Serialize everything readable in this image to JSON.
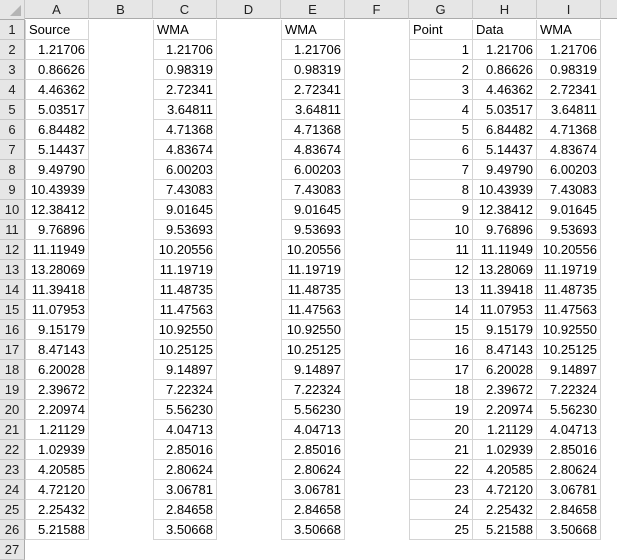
{
  "columns": [
    "A",
    "B",
    "C",
    "D",
    "E",
    "F",
    "G",
    "H",
    "I"
  ],
  "row_numbers": [
    1,
    2,
    3,
    4,
    5,
    6,
    7,
    8,
    9,
    10,
    11,
    12,
    13,
    14,
    15,
    16,
    17,
    18,
    19,
    20,
    21,
    22,
    23,
    24,
    25,
    26,
    27
  ],
  "headers": {
    "A": "Source",
    "C": "WMA",
    "E": "WMA",
    "G": "Point",
    "H": "Data",
    "I": "WMA"
  },
  "source": [
    "1.21706",
    "0.86626",
    "4.46362",
    "5.03517",
    "6.84482",
    "5.14437",
    "9.49790",
    "10.43939",
    "12.38412",
    "9.76896",
    "11.11949",
    "13.28069",
    "11.39418",
    "11.07953",
    "9.15179",
    "8.47143",
    "6.20028",
    "2.39672",
    "2.20974",
    "1.21129",
    "1.02939",
    "4.20585",
    "4.72120",
    "2.25432",
    "5.21588"
  ],
  "wma_c": [
    "1.21706",
    "0.98319",
    "2.72341",
    "3.64811",
    "4.71368",
    "4.83674",
    "6.00203",
    "7.43083",
    "9.01645",
    "9.53693",
    "10.20556",
    "11.19719",
    "11.48735",
    "11.47563",
    "10.92550",
    "10.25125",
    "9.14897",
    "7.22324",
    "5.56230",
    "4.04713",
    "2.85016",
    "2.80624",
    "3.06781",
    "2.84658",
    "3.50668"
  ],
  "wma_e": [
    "1.21706",
    "0.98319",
    "2.72341",
    "3.64811",
    "4.71368",
    "4.83674",
    "6.00203",
    "7.43083",
    "9.01645",
    "9.53693",
    "10.20556",
    "11.19719",
    "11.48735",
    "11.47563",
    "10.92550",
    "10.25125",
    "9.14897",
    "7.22324",
    "5.56230",
    "4.04713",
    "2.85016",
    "2.80624",
    "3.06781",
    "2.84658",
    "3.50668"
  ],
  "points": [
    "1",
    "2",
    "3",
    "4",
    "5",
    "6",
    "7",
    "8",
    "9",
    "10",
    "11",
    "12",
    "13",
    "14",
    "15",
    "16",
    "17",
    "18",
    "19",
    "20",
    "21",
    "22",
    "23",
    "24",
    "25"
  ],
  "data_h": [
    "1.21706",
    "0.86626",
    "4.46362",
    "5.03517",
    "6.84482",
    "5.14437",
    "9.49790",
    "10.43939",
    "12.38412",
    "9.76896",
    "11.11949",
    "13.28069",
    "11.39418",
    "11.07953",
    "9.15179",
    "8.47143",
    "6.20028",
    "2.39672",
    "2.20974",
    "1.21129",
    "1.02939",
    "4.20585",
    "4.72120",
    "2.25432",
    "5.21588"
  ],
  "wma_i": [
    "1.21706",
    "0.98319",
    "2.72341",
    "3.64811",
    "4.71368",
    "4.83674",
    "6.00203",
    "7.43083",
    "9.01645",
    "9.53693",
    "10.20556",
    "11.19719",
    "11.48735",
    "11.47563",
    "10.92550",
    "10.25125",
    "9.14897",
    "7.22324",
    "5.56230",
    "4.04713",
    "2.85016",
    "2.80624",
    "3.06781",
    "2.84658",
    "3.50668"
  ]
}
